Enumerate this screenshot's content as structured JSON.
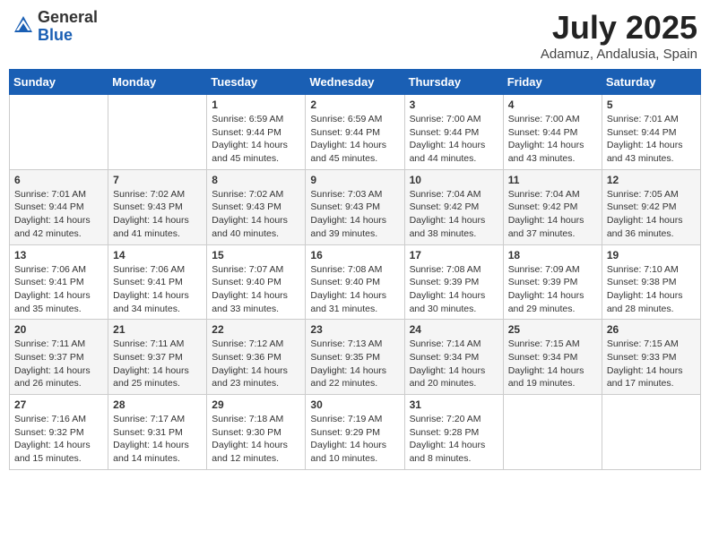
{
  "header": {
    "logo_general": "General",
    "logo_blue": "Blue",
    "month_title": "July 2025",
    "location": "Adamuz, Andalusia, Spain"
  },
  "weekdays": [
    "Sunday",
    "Monday",
    "Tuesday",
    "Wednesday",
    "Thursday",
    "Friday",
    "Saturday"
  ],
  "weeks": [
    [
      {
        "day": "",
        "sunrise": "",
        "sunset": "",
        "daylight": ""
      },
      {
        "day": "",
        "sunrise": "",
        "sunset": "",
        "daylight": ""
      },
      {
        "day": "1",
        "sunrise": "Sunrise: 6:59 AM",
        "sunset": "Sunset: 9:44 PM",
        "daylight": "Daylight: 14 hours and 45 minutes."
      },
      {
        "day": "2",
        "sunrise": "Sunrise: 6:59 AM",
        "sunset": "Sunset: 9:44 PM",
        "daylight": "Daylight: 14 hours and 45 minutes."
      },
      {
        "day": "3",
        "sunrise": "Sunrise: 7:00 AM",
        "sunset": "Sunset: 9:44 PM",
        "daylight": "Daylight: 14 hours and 44 minutes."
      },
      {
        "day": "4",
        "sunrise": "Sunrise: 7:00 AM",
        "sunset": "Sunset: 9:44 PM",
        "daylight": "Daylight: 14 hours and 43 minutes."
      },
      {
        "day": "5",
        "sunrise": "Sunrise: 7:01 AM",
        "sunset": "Sunset: 9:44 PM",
        "daylight": "Daylight: 14 hours and 43 minutes."
      }
    ],
    [
      {
        "day": "6",
        "sunrise": "Sunrise: 7:01 AM",
        "sunset": "Sunset: 9:44 PM",
        "daylight": "Daylight: 14 hours and 42 minutes."
      },
      {
        "day": "7",
        "sunrise": "Sunrise: 7:02 AM",
        "sunset": "Sunset: 9:43 PM",
        "daylight": "Daylight: 14 hours and 41 minutes."
      },
      {
        "day": "8",
        "sunrise": "Sunrise: 7:02 AM",
        "sunset": "Sunset: 9:43 PM",
        "daylight": "Daylight: 14 hours and 40 minutes."
      },
      {
        "day": "9",
        "sunrise": "Sunrise: 7:03 AM",
        "sunset": "Sunset: 9:43 PM",
        "daylight": "Daylight: 14 hours and 39 minutes."
      },
      {
        "day": "10",
        "sunrise": "Sunrise: 7:04 AM",
        "sunset": "Sunset: 9:42 PM",
        "daylight": "Daylight: 14 hours and 38 minutes."
      },
      {
        "day": "11",
        "sunrise": "Sunrise: 7:04 AM",
        "sunset": "Sunset: 9:42 PM",
        "daylight": "Daylight: 14 hours and 37 minutes."
      },
      {
        "day": "12",
        "sunrise": "Sunrise: 7:05 AM",
        "sunset": "Sunset: 9:42 PM",
        "daylight": "Daylight: 14 hours and 36 minutes."
      }
    ],
    [
      {
        "day": "13",
        "sunrise": "Sunrise: 7:06 AM",
        "sunset": "Sunset: 9:41 PM",
        "daylight": "Daylight: 14 hours and 35 minutes."
      },
      {
        "day": "14",
        "sunrise": "Sunrise: 7:06 AM",
        "sunset": "Sunset: 9:41 PM",
        "daylight": "Daylight: 14 hours and 34 minutes."
      },
      {
        "day": "15",
        "sunrise": "Sunrise: 7:07 AM",
        "sunset": "Sunset: 9:40 PM",
        "daylight": "Daylight: 14 hours and 33 minutes."
      },
      {
        "day": "16",
        "sunrise": "Sunrise: 7:08 AM",
        "sunset": "Sunset: 9:40 PM",
        "daylight": "Daylight: 14 hours and 31 minutes."
      },
      {
        "day": "17",
        "sunrise": "Sunrise: 7:08 AM",
        "sunset": "Sunset: 9:39 PM",
        "daylight": "Daylight: 14 hours and 30 minutes."
      },
      {
        "day": "18",
        "sunrise": "Sunrise: 7:09 AM",
        "sunset": "Sunset: 9:39 PM",
        "daylight": "Daylight: 14 hours and 29 minutes."
      },
      {
        "day": "19",
        "sunrise": "Sunrise: 7:10 AM",
        "sunset": "Sunset: 9:38 PM",
        "daylight": "Daylight: 14 hours and 28 minutes."
      }
    ],
    [
      {
        "day": "20",
        "sunrise": "Sunrise: 7:11 AM",
        "sunset": "Sunset: 9:37 PM",
        "daylight": "Daylight: 14 hours and 26 minutes."
      },
      {
        "day": "21",
        "sunrise": "Sunrise: 7:11 AM",
        "sunset": "Sunset: 9:37 PM",
        "daylight": "Daylight: 14 hours and 25 minutes."
      },
      {
        "day": "22",
        "sunrise": "Sunrise: 7:12 AM",
        "sunset": "Sunset: 9:36 PM",
        "daylight": "Daylight: 14 hours and 23 minutes."
      },
      {
        "day": "23",
        "sunrise": "Sunrise: 7:13 AM",
        "sunset": "Sunset: 9:35 PM",
        "daylight": "Daylight: 14 hours and 22 minutes."
      },
      {
        "day": "24",
        "sunrise": "Sunrise: 7:14 AM",
        "sunset": "Sunset: 9:34 PM",
        "daylight": "Daylight: 14 hours and 20 minutes."
      },
      {
        "day": "25",
        "sunrise": "Sunrise: 7:15 AM",
        "sunset": "Sunset: 9:34 PM",
        "daylight": "Daylight: 14 hours and 19 minutes."
      },
      {
        "day": "26",
        "sunrise": "Sunrise: 7:15 AM",
        "sunset": "Sunset: 9:33 PM",
        "daylight": "Daylight: 14 hours and 17 minutes."
      }
    ],
    [
      {
        "day": "27",
        "sunrise": "Sunrise: 7:16 AM",
        "sunset": "Sunset: 9:32 PM",
        "daylight": "Daylight: 14 hours and 15 minutes."
      },
      {
        "day": "28",
        "sunrise": "Sunrise: 7:17 AM",
        "sunset": "Sunset: 9:31 PM",
        "daylight": "Daylight: 14 hours and 14 minutes."
      },
      {
        "day": "29",
        "sunrise": "Sunrise: 7:18 AM",
        "sunset": "Sunset: 9:30 PM",
        "daylight": "Daylight: 14 hours and 12 minutes."
      },
      {
        "day": "30",
        "sunrise": "Sunrise: 7:19 AM",
        "sunset": "Sunset: 9:29 PM",
        "daylight": "Daylight: 14 hours and 10 minutes."
      },
      {
        "day": "31",
        "sunrise": "Sunrise: 7:20 AM",
        "sunset": "Sunset: 9:28 PM",
        "daylight": "Daylight: 14 hours and 8 minutes."
      },
      {
        "day": "",
        "sunrise": "",
        "sunset": "",
        "daylight": ""
      },
      {
        "day": "",
        "sunrise": "",
        "sunset": "",
        "daylight": ""
      }
    ]
  ]
}
